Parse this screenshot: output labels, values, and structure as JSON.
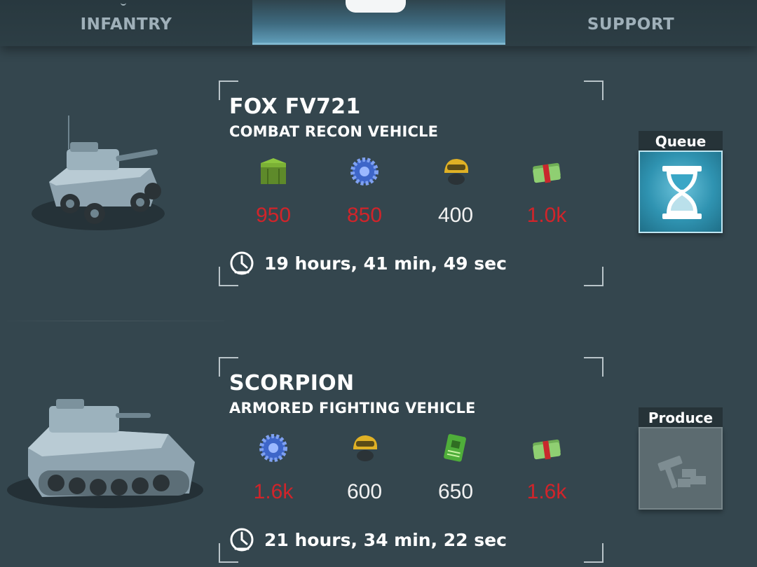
{
  "tabs": {
    "infantry": "INFANTRY",
    "vehicles": "",
    "support": "SUPPORT"
  },
  "units": [
    {
      "name": "FOX FV721",
      "type": "COMBAT RECON VEHICLE",
      "resources": [
        {
          "icon": "supply-crate-icon",
          "value": "950",
          "status": "insufficient"
        },
        {
          "icon": "gear-parts-icon",
          "value": "850",
          "status": "insufficient"
        },
        {
          "icon": "soldier-helmet-icon",
          "value": "400",
          "status": "available"
        },
        {
          "icon": "cash-bundle-icon",
          "value": "1.0k",
          "status": "insufficient"
        }
      ],
      "time": "19 hours, 41 min, 49 sec",
      "action": "Queue",
      "action_icon": "hourglass-icon"
    },
    {
      "name": "SCORPION",
      "type": "ARMORED FIGHTING VEHICLE",
      "resources": [
        {
          "icon": "gear-parts-icon",
          "value": "1.6k",
          "status": "insufficient"
        },
        {
          "icon": "soldier-helmet-icon",
          "value": "600",
          "status": "available"
        },
        {
          "icon": "circuit-board-icon",
          "value": "650",
          "status": "available"
        },
        {
          "icon": "cash-bundle-icon",
          "value": "1.6k",
          "status": "insufficient"
        }
      ],
      "time": "21 hours, 34 min, 22 sec",
      "action": "Produce",
      "action_icon": "build-hammer-icon"
    }
  ],
  "colors": {
    "insufficient": "#d1242a",
    "available": "#f2f2f2",
    "accent": "#2f93b1",
    "background": "#34464e"
  }
}
